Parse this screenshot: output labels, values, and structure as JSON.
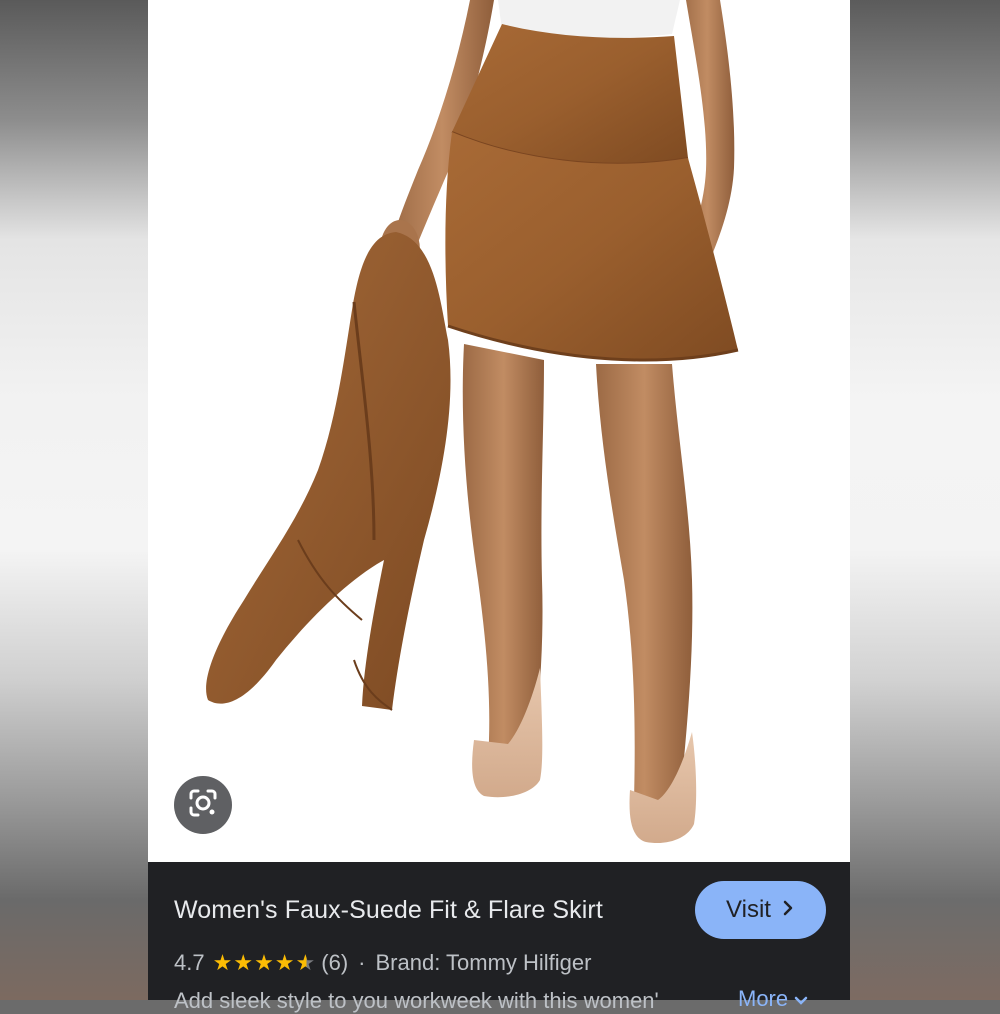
{
  "product": {
    "title": "Women's Faux-Suede Fit & Flare Skirt",
    "rating": "4.7",
    "rating_value": 4.7,
    "review_count": "(6)",
    "separator": "·",
    "brand": "Brand: Tommy Hilfiger",
    "description": "Add sleek style to you workweek with this women'",
    "more_label": "More"
  },
  "actions": {
    "visit_label": "Visit"
  },
  "icons": {
    "lens": "google-lens-icon",
    "visit": "chevron-right-icon",
    "more": "chevron-down-icon",
    "star": "star-icon"
  },
  "colors": {
    "panel_bg": "#202124",
    "accent": "#8ab4f8",
    "star": "#fbbc04",
    "suede": "#9a5f2e"
  }
}
